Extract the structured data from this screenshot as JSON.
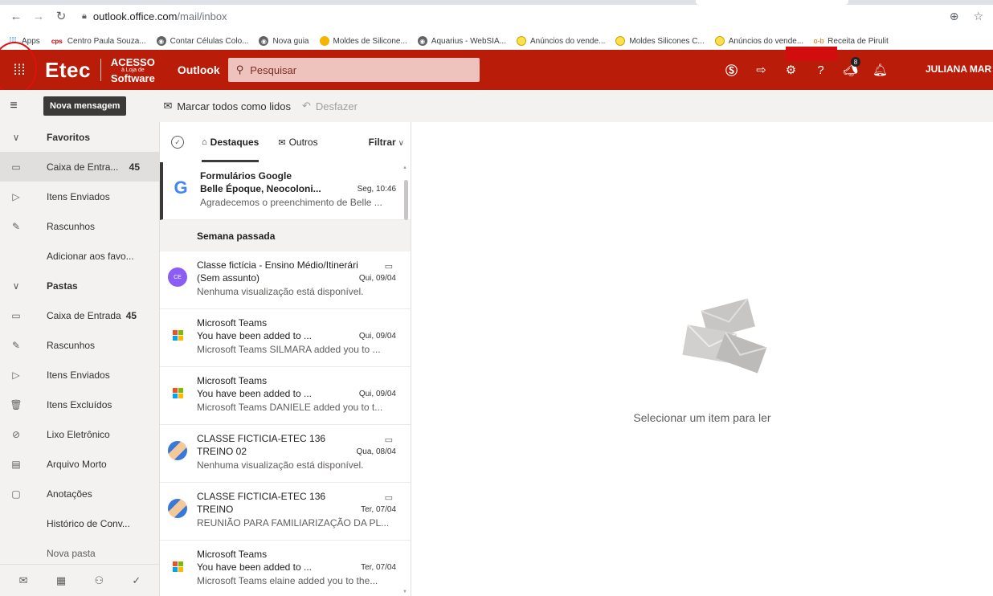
{
  "browser": {
    "url_host": "outlook.office.com",
    "url_path": "/mail/inbox",
    "bookmarks": [
      {
        "label": "Apps"
      },
      {
        "label": "Centro Paula Souza..."
      },
      {
        "label": "Contar Células Colo..."
      },
      {
        "label": "Nova guia"
      },
      {
        "label": "Moldes de Silicone..."
      },
      {
        "label": "Aquarius - WebSIA..."
      },
      {
        "label": "Anúncios do vende..."
      },
      {
        "label": "Moldes Silicones C..."
      },
      {
        "label": "Anúncios do vende..."
      },
      {
        "label": "Receita de Pirulit"
      }
    ]
  },
  "header": {
    "logo_main": "Etec",
    "logo_acesso": "ACESSO",
    "logo_loja": "à Loja de",
    "logo_software": "Software",
    "app_name": "Outlook",
    "search_placeholder": "Pesquisar",
    "notification_count": "8",
    "user_name": "JULIANA MAR",
    "accent": "#b91c09"
  },
  "commandbar": {
    "new_message": "Nova mensagem",
    "mark_all_read": "Marcar todos como lidos",
    "undo": "Desfazer"
  },
  "nav": {
    "favorites": "Favoritos",
    "fav_inbox": "Caixa de Entra...",
    "fav_inbox_count": "45",
    "fav_sent": "Itens Enviados",
    "fav_drafts": "Rascunhos",
    "add_fav": "Adicionar aos favo...",
    "folders": "Pastas",
    "inbox": "Caixa de Entrada",
    "inbox_count": "45",
    "drafts": "Rascunhos",
    "sent": "Itens Enviados",
    "deleted": "Itens Excluídos",
    "junk": "Lixo Eletrônico",
    "archive": "Arquivo Morto",
    "notes": "Anotações",
    "history": "Histórico de Conv...",
    "new_folder": "Nova pasta"
  },
  "list": {
    "tab_focused": "Destaques",
    "tab_other": "Outros",
    "filter": "Filtrar",
    "group_last_week": "Semana passada",
    "messages": [
      {
        "sender": "Formulários Google",
        "subject": "Belle Époque, Neocoloni...",
        "date": "Seg, 10:46",
        "preview": "Agradecemos o preenchimento de Belle ..."
      },
      {
        "sender": "Classe fictícia - Ensino Médio/Itinerári",
        "subject": "(Sem assunto)",
        "date": "Qui, 09/04",
        "preview": "Nenhuma visualização está disponível.",
        "avatar_text": "CE"
      },
      {
        "sender": "Microsoft Teams",
        "subject": "You have been added to ...",
        "date": "Qui, 09/04",
        "preview": "Microsoft Teams SILMARA added you to ..."
      },
      {
        "sender": "Microsoft Teams",
        "subject": "You have been added to ...",
        "date": "Qui, 09/04",
        "preview": "Microsoft Teams DANIELE added you to t..."
      },
      {
        "sender": "CLASSE FICTICIA-ETEC 136",
        "subject": "TREINO 02",
        "date": "Qua, 08/04",
        "preview": "Nenhuma visualização está disponível."
      },
      {
        "sender": "CLASSE FICTICIA-ETEC 136",
        "subject": "TREINO",
        "date": "Ter, 07/04",
        "preview": "REUNIÃO PARA FAMILIARIZAÇÃO DA PL..."
      },
      {
        "sender": "Microsoft Teams",
        "subject": "You have been added to ...",
        "date": "Ter, 07/04",
        "preview": "Microsoft Teams elaine added you to the..."
      }
    ]
  },
  "reading": {
    "empty_text": "Selecionar um item para ler"
  }
}
